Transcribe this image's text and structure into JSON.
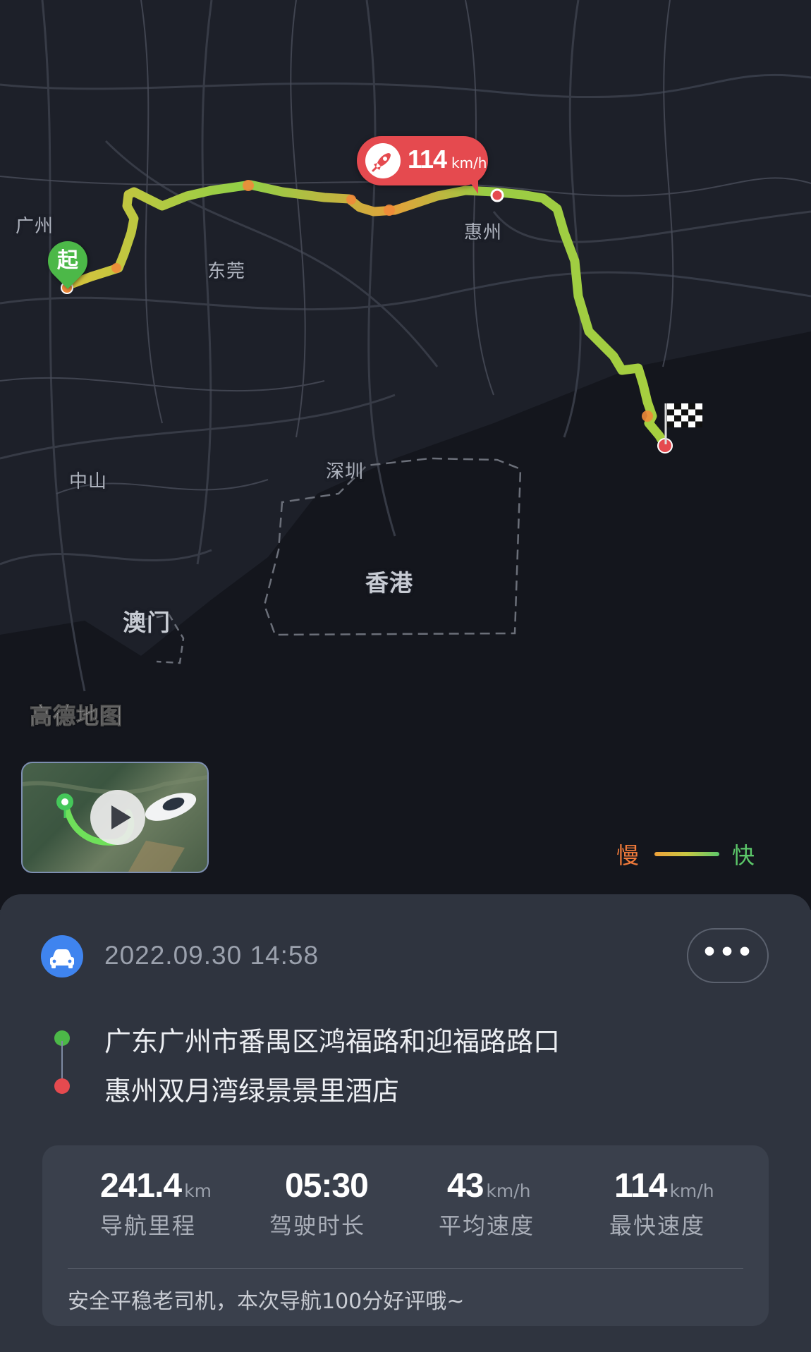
{
  "map": {
    "cities": {
      "guangzhou": "广州",
      "dongguan": "东莞",
      "huizhou": "惠州",
      "zhongshan": "中山",
      "shenzhen": "深圳",
      "hongkong": "香港",
      "macau": "澳门"
    },
    "provider_logo": "高德地图",
    "start_marker": "起",
    "max_speed_bubble": {
      "value": "114",
      "unit": "km/h"
    },
    "legend": {
      "slow": "慢",
      "fast": "快"
    },
    "colors": {
      "slow": "#f07a3a",
      "fast": "#5cc86a",
      "mid": "#c8d045",
      "end": "#e54a4f"
    }
  },
  "trip": {
    "datetime": "2022.09.30 14:58",
    "more_label": "•••",
    "start_address": "广东广州市番禺区鸿福路和迎福路路口",
    "end_address": "惠州双月湾绿景景里酒店",
    "stats": [
      {
        "value": "241.4",
        "unit": "km",
        "label": "导航里程"
      },
      {
        "value": "05:30",
        "unit": "",
        "label": "驾驶时长"
      },
      {
        "value": "43",
        "unit": "km/h",
        "label": "平均速度"
      },
      {
        "value": "114",
        "unit": "km/h",
        "label": "最快速度"
      }
    ],
    "comment": "安全平稳老司机，本次导航100分好评哦~",
    "colors": {
      "start_dot": "#4cb848",
      "end_dot": "#e54a4f",
      "car_icon_bg": "#3f84ef"
    }
  }
}
